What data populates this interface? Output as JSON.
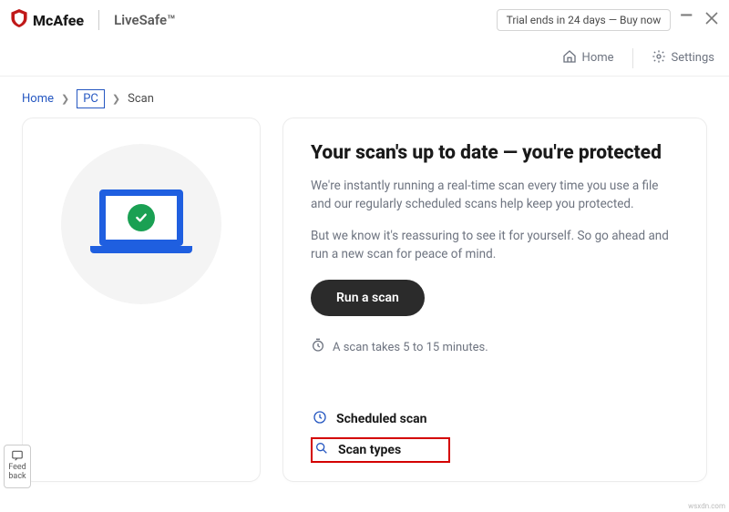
{
  "titlebar": {
    "brand": "McAfee",
    "product": "LiveSafe™",
    "trial_label": "Trial ends in 24 days — Buy now"
  },
  "navbar": {
    "home_label": "Home",
    "settings_label": "Settings"
  },
  "breadcrumb": {
    "home": "Home",
    "pc": "PC",
    "scan": "Scan"
  },
  "main": {
    "heading": "Your scan's up to date — you're protected",
    "para1": "We're instantly running a real-time scan every time you use a file and our regularly scheduled scans help keep you protected.",
    "para2": "But we know it's reassuring to see it for yourself. So go ahead and run a new scan for peace of mind.",
    "run_label": "Run a scan",
    "hint": "A scan takes 5 to 15 minutes.",
    "scheduled_label": "Scheduled scan",
    "types_label": "Scan types"
  },
  "feedback": {
    "line1": "Feed",
    "line2": "back"
  },
  "watermark": "wsxdn.com"
}
